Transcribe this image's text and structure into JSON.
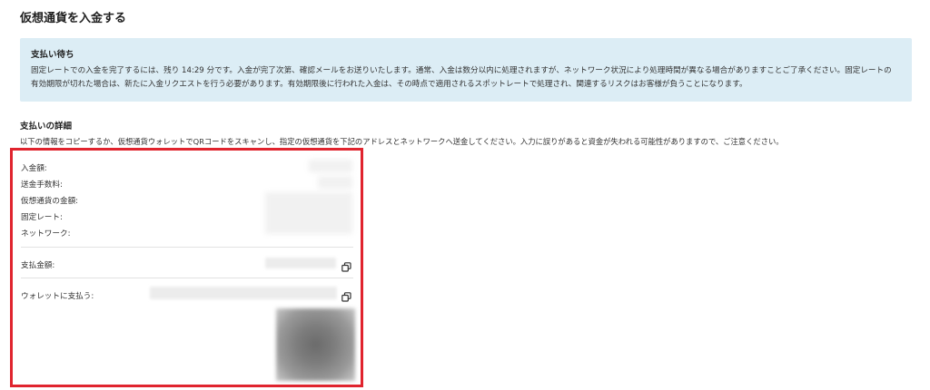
{
  "page": {
    "title": "仮想通貨を入金する"
  },
  "notice": {
    "title": "支払い待ち",
    "line1": "固定レートでの入金を完了するには、残り 14:29 分です。入金が完了次第、確認メールをお送りいたします。通常、入金は数分以内に処理されますが、ネットワーク状況により処理時間が異なる場合がありますことご了承ください。固定レートの",
    "line2": "有効期限が切れた場合は、新たに入金リクエストを行う必要があります。有効期限後に行われた入金は、その時点で適用されるスポットレートで処理され、関連するリスクはお客様が負うことになります。"
  },
  "details": {
    "title": "支払いの詳細",
    "description": "以下の情報をコピーするか、仮想通貨ウォレットでQRコードをスキャンし、指定の仮想通貨を下記のアドレスとネットワークへ送金してください。入力に誤りがあると資金が失われる可能性がありますので、ご注意ください。",
    "labels": {
      "deposit_amount": "入金額:",
      "fee": "送金手数料:",
      "crypto_amount": "仮想通貨の金額:",
      "fixed_rate": "固定レート:",
      "network": "ネットワーク:",
      "payment_amount": "支払金額:",
      "pay_to_wallet": "ウォレットに支払う:"
    }
  },
  "icons": {
    "copy": "copy-icon"
  },
  "colors": {
    "notice_bg": "#dcedf5",
    "highlight_border": "#e0242e"
  }
}
